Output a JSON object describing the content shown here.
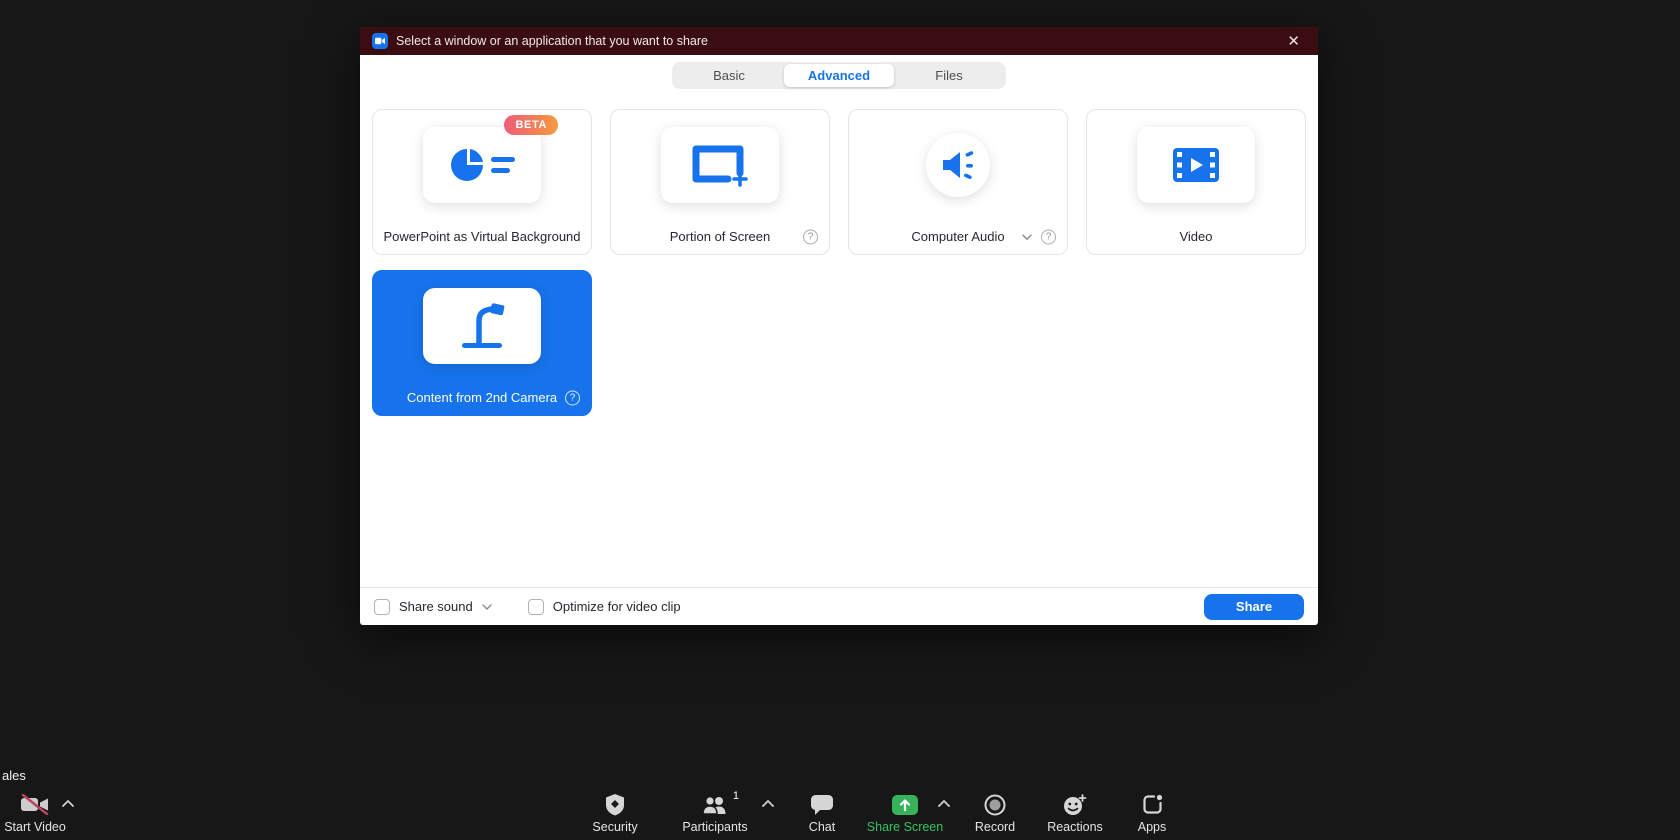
{
  "window": {
    "title": "Select a window or an application that you want to share",
    "close": "✕"
  },
  "tabs": [
    {
      "label": "Basic",
      "active": false
    },
    {
      "label": "Advanced",
      "active": true
    },
    {
      "label": "Files",
      "active": false
    }
  ],
  "cards": [
    {
      "label": "PowerPoint as Virtual Background",
      "badge": "BETA",
      "icon": "pie-chart-presentation-icon",
      "selected": false
    },
    {
      "label": "Portion of Screen",
      "icon": "screen-region-icon",
      "help": "?",
      "selected": false
    },
    {
      "label": "Computer Audio",
      "icon": "speaker-icon",
      "help": "?",
      "has_dropdown": true,
      "selected": false
    },
    {
      "label": "Video",
      "icon": "film-strip-icon",
      "selected": false
    },
    {
      "label": "Content from 2nd Camera",
      "icon": "document-camera-icon",
      "help": "?",
      "selected": true
    }
  ],
  "footer": {
    "share_sound": "Share sound",
    "share_sound_checked": false,
    "optimize": "Optimize for video clip",
    "optimize_checked": false,
    "share": "Share"
  },
  "toolbar": {
    "name_tag": "ales",
    "start_video": "Start Video",
    "security": "Security",
    "participants": "Participants",
    "participants_count": "1",
    "chat": "Chat",
    "share_screen": "Share Screen",
    "record": "Record",
    "reactions": "Reactions",
    "apps": "Apps"
  },
  "colors": {
    "accent_blue": "#1773EB",
    "titlebar_maroon": "#3A0D12",
    "share_green": "#36B35A",
    "share_green_text": "#35C463",
    "beta_gradient_start": "#EE5D7A",
    "beta_gradient_end": "#F59A3E",
    "video_off_slash_red": "#B9455A"
  }
}
